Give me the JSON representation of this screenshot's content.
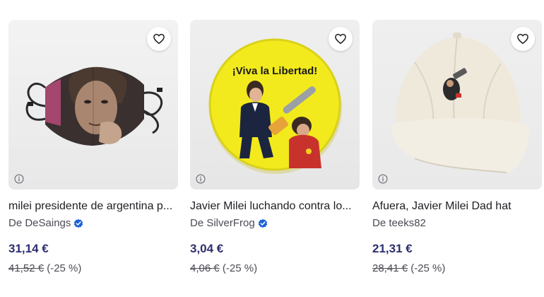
{
  "products": [
    {
      "title": "milei presidente de argentina p...",
      "seller": "De DeSaings",
      "verified": true,
      "price": "31,14 €",
      "old_price": "41,52 €",
      "discount": "(-25 %)",
      "image_icon": "face-mask-image"
    },
    {
      "title": "Javier Milei luchando contra lo...",
      "seller": "De SilverFrog",
      "verified": true,
      "price": "3,04 €",
      "old_price": "4,06 €",
      "discount": "(-25 %)",
      "image_icon": "pin-button-image",
      "image_text": "¡Viva la Libertad!"
    },
    {
      "title": "Afuera, Javier Milei Dad hat",
      "seller": "De teeks82",
      "verified": false,
      "price": "21,31 €",
      "old_price": "28,41 €",
      "discount": "(-25 %)",
      "image_icon": "dad-hat-image"
    }
  ],
  "colors": {
    "price": "#2d2f6e",
    "verified_badge": "#1d62d6",
    "pin_yellow": "#f2ea1c"
  }
}
